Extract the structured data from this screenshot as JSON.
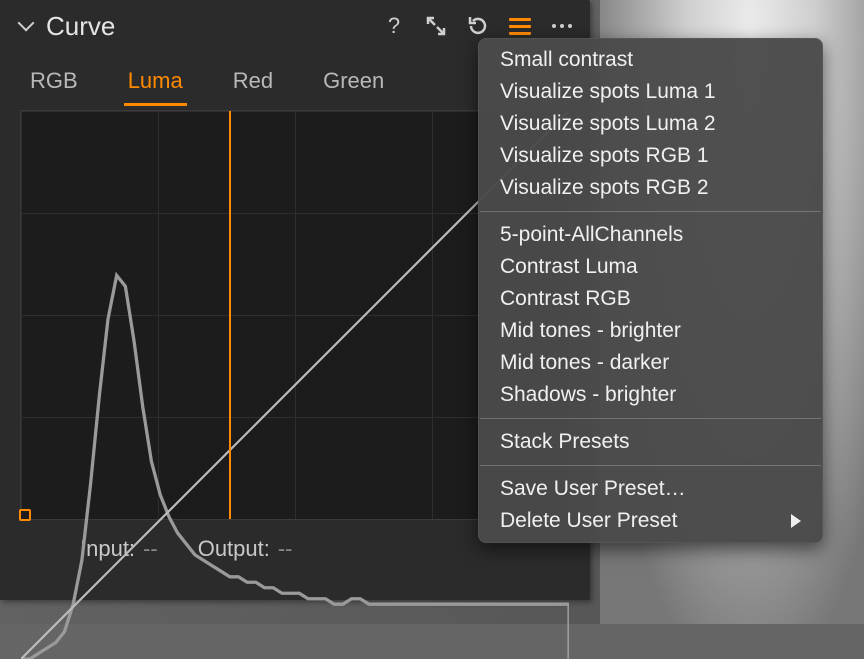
{
  "panel": {
    "title": "Curve",
    "tabs": [
      "RGB",
      "Luma",
      "Red",
      "Green"
    ],
    "active_tab_index": 1,
    "input_label": "Input:",
    "output_label": "Output:",
    "input_value": "--",
    "output_value": "--",
    "accent_color": "#ff8a00"
  },
  "chart_data": {
    "type": "line",
    "x_range": [
      0,
      255
    ],
    "y_range": [
      0,
      255
    ],
    "marker_x": 97,
    "control_points": [
      [
        0,
        0
      ],
      [
        255,
        255
      ]
    ],
    "histogram_relative": [
      0.0,
      0.0,
      0.01,
      0.02,
      0.03,
      0.05,
      0.1,
      0.18,
      0.32,
      0.48,
      0.62,
      0.7,
      0.68,
      0.58,
      0.46,
      0.36,
      0.3,
      0.26,
      0.23,
      0.21,
      0.19,
      0.18,
      0.17,
      0.16,
      0.15,
      0.15,
      0.14,
      0.14,
      0.13,
      0.13,
      0.12,
      0.12,
      0.12,
      0.11,
      0.11,
      0.11,
      0.1,
      0.1,
      0.11,
      0.11,
      0.1,
      0.1,
      0.1,
      0.1,
      0.1,
      0.1,
      0.1,
      0.1,
      0.1,
      0.1,
      0.1,
      0.1,
      0.1,
      0.1,
      0.1,
      0.1,
      0.1,
      0.1,
      0.1,
      0.1,
      0.1,
      0.1,
      0.1,
      0.1
    ]
  },
  "menu": {
    "groups": [
      {
        "items": [
          "Small contrast",
          "Visualize spots Luma 1",
          "Visualize spots Luma 2",
          "Visualize spots RGB 1",
          "Visualize spots RGB 2"
        ]
      },
      {
        "items": [
          "5-point-AllChannels",
          "Contrast Luma",
          "Contrast RGB",
          "Mid tones - brighter",
          "Mid tones - darker",
          "Shadows - brighter"
        ]
      },
      {
        "items": [
          "Stack Presets"
        ]
      },
      {
        "items": [
          "Save User Preset…",
          "Delete User Preset"
        ],
        "submenu_index": 1
      }
    ]
  }
}
